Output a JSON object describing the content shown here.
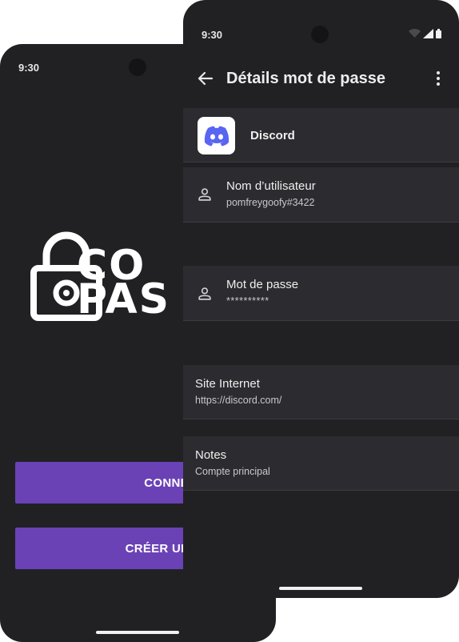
{
  "back_screen": {
    "status_time": "9:30",
    "logo_text_line1": "CO",
    "logo_text_line2": "PAS",
    "login_button": "CONNEXION",
    "create_account_button": "CRÉER UN COMPT"
  },
  "front_screen": {
    "status_time": "9:30",
    "title": "Détails mot de passe",
    "app": {
      "name": "Discord",
      "icon": "discord-logo-icon"
    },
    "fields": {
      "username": {
        "label": "Nom d’utilisateur",
        "value": "pomfreygoofy#3422",
        "icon": "person-icon"
      },
      "password": {
        "label": "Mot de passe",
        "value": "**********",
        "icon": "person-icon"
      },
      "website": {
        "label": "Site Internet",
        "value": "https://discord.com/"
      },
      "notes": {
        "label": "Notes",
        "value": "Compte principal"
      }
    }
  },
  "colors": {
    "background": "#212124",
    "card": "#2c2c30",
    "accent": "#6a42b6",
    "discord": "#5865f2"
  }
}
